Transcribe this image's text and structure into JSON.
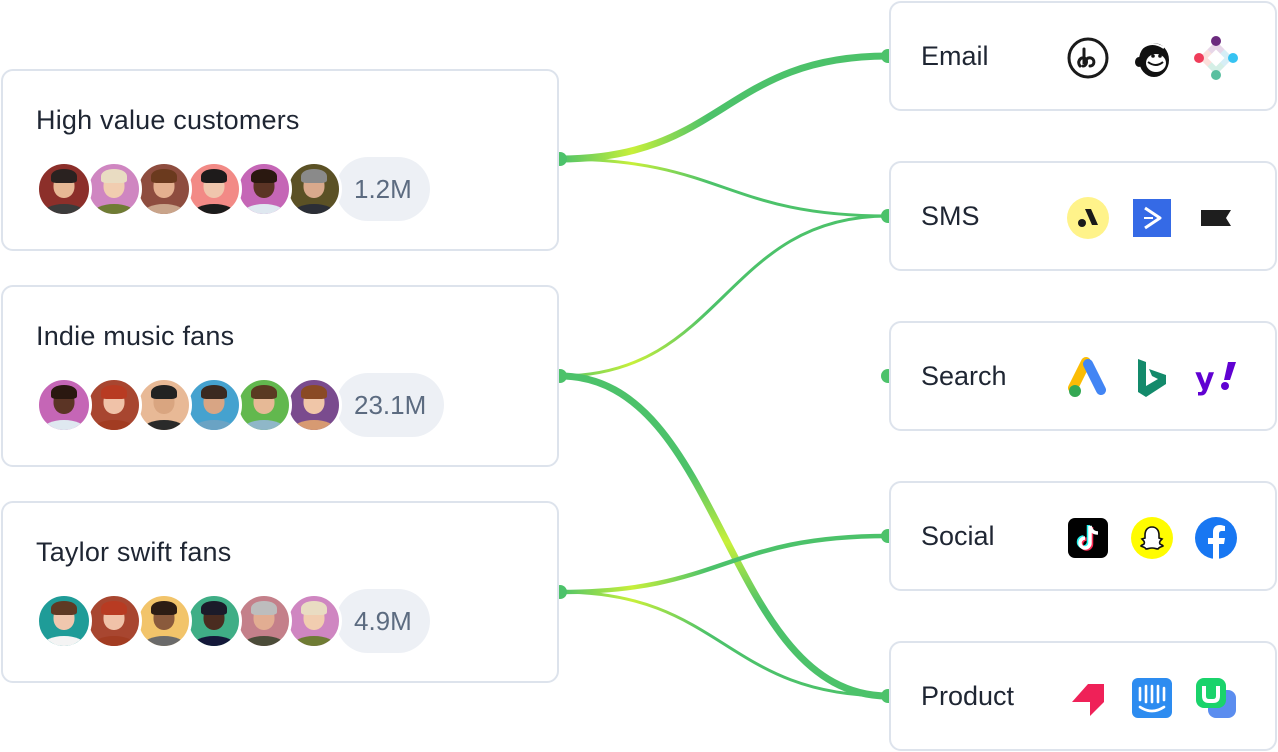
{
  "segments": [
    {
      "id": "high-value",
      "title": "High value customers",
      "count": "1.2M",
      "avatars": [
        {
          "bg": "#8c2f2a",
          "skin": "#e7b895",
          "hair": "#2a2220",
          "shirt": "#3b3b3b"
        },
        {
          "bg": "#cf86c1",
          "skin": "#f1cdb0",
          "hair": "#e9dcc2",
          "shirt": "#6f7c34"
        },
        {
          "bg": "#8e4d3f",
          "skin": "#e4b08f",
          "hair": "#6b3a1e",
          "shirt": "#c9a48a"
        },
        {
          "bg": "#f28a86",
          "skin": "#f0c6ad",
          "hair": "#1e1b1b",
          "shirt": "#1b1b1b"
        },
        {
          "bg": "#c566b6",
          "skin": "#5b3425",
          "hair": "#2a1810",
          "shirt": "#dfe8f0"
        },
        {
          "bg": "#5b5125",
          "skin": "#d9a98c",
          "hair": "#8a8a8a",
          "shirt": "#2b2e36"
        }
      ]
    },
    {
      "id": "indie-music",
      "title": "Indie music fans",
      "count": "23.1M",
      "avatars": [
        {
          "bg": "#c566b6",
          "skin": "#5b3425",
          "hair": "#2a1810",
          "shirt": "#dfe8f0"
        },
        {
          "bg": "#a84630",
          "skin": "#f0c2a8",
          "hair": "#b83b22",
          "shirt": "#a23c22"
        },
        {
          "bg": "#e8b996",
          "skin": "#d9a580",
          "hair": "#222222",
          "shirt": "#2a2a2a"
        },
        {
          "bg": "#45a2cf",
          "skin": "#d8a584",
          "hair": "#3b2a20",
          "shirt": "#6aa3c4"
        },
        {
          "bg": "#62b84e",
          "skin": "#e6b996",
          "hair": "#5a3a22",
          "shirt": "#8fb7c8"
        },
        {
          "bg": "#7a4b8e",
          "skin": "#f0c6a8",
          "hair": "#8a4a25",
          "shirt": "#d79a72"
        }
      ]
    },
    {
      "id": "taylor-swift",
      "title": "Taylor swift fans",
      "count": "4.9M",
      "avatars": [
        {
          "bg": "#1f9c98",
          "skin": "#f0c7ae",
          "hair": "#5e3a24",
          "shirt": "#f4f4f4"
        },
        {
          "bg": "#a84630",
          "skin": "#f0c2a8",
          "hair": "#b83b22",
          "shirt": "#a23c22"
        },
        {
          "bg": "#f2c46a",
          "skin": "#8a5a3c",
          "hair": "#2d1d14",
          "shirt": "#6a6a6a"
        },
        {
          "bg": "#3fae86",
          "skin": "#4a2c20",
          "hair": "#1b1b2a",
          "shirt": "#14183a"
        },
        {
          "bg": "#c4808a",
          "skin": "#e2ad92",
          "hair": "#bdbdbd",
          "shirt": "#4b4c39"
        },
        {
          "bg": "#cf86c1",
          "skin": "#f1cdb0",
          "hair": "#e9dcc2",
          "shirt": "#6f7c34"
        }
      ]
    }
  ],
  "channels": [
    {
      "id": "email",
      "label": "Email",
      "icons": [
        "braze-icon",
        "mailchimp-icon",
        "iterable-icon"
      ]
    },
    {
      "id": "sms",
      "label": "SMS",
      "icons": [
        "attentive-icon",
        "activecampaign-icon",
        "klaviyo-icon"
      ]
    },
    {
      "id": "search",
      "label": "Search",
      "icons": [
        "google-ads-icon",
        "bing-icon",
        "yahoo-icon"
      ]
    },
    {
      "id": "social",
      "label": "Social",
      "icons": [
        "tiktok-icon",
        "snapchat-icon",
        "facebook-icon"
      ]
    },
    {
      "id": "product",
      "label": "Product",
      "icons": [
        "braze-product-icon",
        "intercom-icon",
        "userflow-icon"
      ]
    }
  ],
  "connections": [
    {
      "from": "high-value",
      "to": "email",
      "weight": "heavy"
    },
    {
      "from": "high-value",
      "to": "sms",
      "weight": "light"
    },
    {
      "from": "indie-music",
      "to": "sms",
      "weight": "light"
    },
    {
      "from": "indie-music",
      "to": "search",
      "weight": "light"
    },
    {
      "from": "indie-music",
      "to": "product",
      "weight": "heavy"
    },
    {
      "from": "taylor-swift",
      "to": "social",
      "weight": "medium"
    },
    {
      "from": "taylor-swift",
      "to": "product",
      "weight": "light"
    }
  ],
  "colors": {
    "line": "#4cc26a",
    "highlight": "#c8f03a",
    "border": "#dde3ec",
    "badge_bg": "#edf0f5",
    "badge_text": "#5c6b80"
  }
}
